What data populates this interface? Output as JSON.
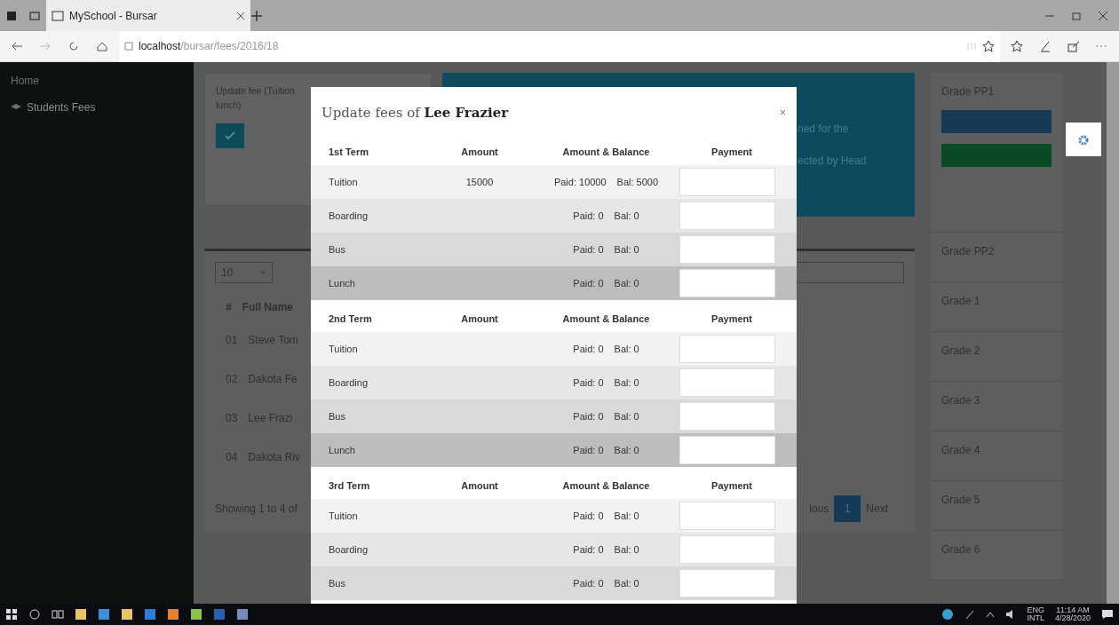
{
  "browser": {
    "tab_title": "MySchool - Bursar",
    "address_host": "localhost",
    "address_path": "/bursar/fees/2016/18"
  },
  "sidebar": {
    "items": [
      {
        "label": "Home",
        "selected": false
      },
      {
        "label": "Students Fees",
        "selected": true
      }
    ]
  },
  "page": {
    "card_text": "Update fee (Tuition",
    "card_text_2": "lunch)",
    "banner_lines": [
      "ned for the",
      "ected by Head"
    ],
    "table": {
      "page_size": "10",
      "header_number": "#",
      "header_name": "Full Name",
      "rows": [
        {
          "number": "01",
          "name": "Steve Tom"
        },
        {
          "number": "02",
          "name": "Dakota Fe"
        },
        {
          "number": "03",
          "name": "Lee Frazi"
        },
        {
          "number": "04",
          "name": "Dakota Riv"
        }
      ],
      "info": "Showing 1 to 4 of",
      "previous": "ious",
      "current_page": "1",
      "next": "Next"
    },
    "grades": [
      {
        "label": "Grade PP1",
        "expanded": true
      },
      {
        "label": "Grade PP2",
        "expanded": false
      },
      {
        "label": "Grade 1",
        "expanded": false
      },
      {
        "label": "Grade 2",
        "expanded": false
      },
      {
        "label": "Grade 3",
        "expanded": false
      },
      {
        "label": "Grade 4",
        "expanded": false
      },
      {
        "label": "Grade 5",
        "expanded": false
      },
      {
        "label": "Grade 6",
        "expanded": false
      }
    ]
  },
  "modal": {
    "title": "Update fees of **Lee Frazier**",
    "close": "×",
    "terms": [
      {
        "name": "1st Term",
        "col_amount": "Amount",
        "col_balance": "Amount & Balance",
        "col_payment": "Payment",
        "items": [
          {
            "name": "Tuition",
            "amount": "15000",
            "paid": "Paid: 10000",
            "bal": "Bal: 5000"
          },
          {
            "name": "Boarding",
            "paid": "Paid: 0",
            "bal": "Bal: 0"
          },
          {
            "name": "Bus",
            "paid": "Paid: 0",
            "bal": "Bal: 0"
          },
          {
            "name": "Lunch",
            "paid": "Paid: 0",
            "bal": "Bal: 0"
          }
        ]
      },
      {
        "name": "2nd Term",
        "col_amount": "Amount",
        "col_balance": "Amount & Balance",
        "col_payment": "Payment",
        "items": [
          {
            "name": "Tuition",
            "paid": "Paid: 0",
            "bal": "Bal: 0"
          },
          {
            "name": "Boarding",
            "paid": "Paid: 0",
            "bal": "Bal: 0"
          },
          {
            "name": "Bus",
            "paid": "Paid: 0",
            "bal": "Bal: 0"
          },
          {
            "name": "Lunch",
            "paid": "Paid: 0",
            "bal": "Bal: 0"
          }
        ]
      },
      {
        "name": "3rd Term",
        "col_amount": "Amount",
        "col_balance": "Amount & Balance",
        "col_payment": "Payment",
        "items": [
          {
            "name": "Tuition",
            "paid": "Paid: 0",
            "bal": "Bal: 0"
          },
          {
            "name": "Boarding",
            "paid": "Paid: 0",
            "bal": "Bal: 0"
          },
          {
            "name": "Bus",
            "paid": "Paid: 0",
            "bal": "Bal: 0"
          }
        ]
      }
    ]
  },
  "taskbar": {
    "lang": "ENG",
    "layout": "INTL",
    "time": "11:14 AM",
    "date": "4/28/2020"
  }
}
